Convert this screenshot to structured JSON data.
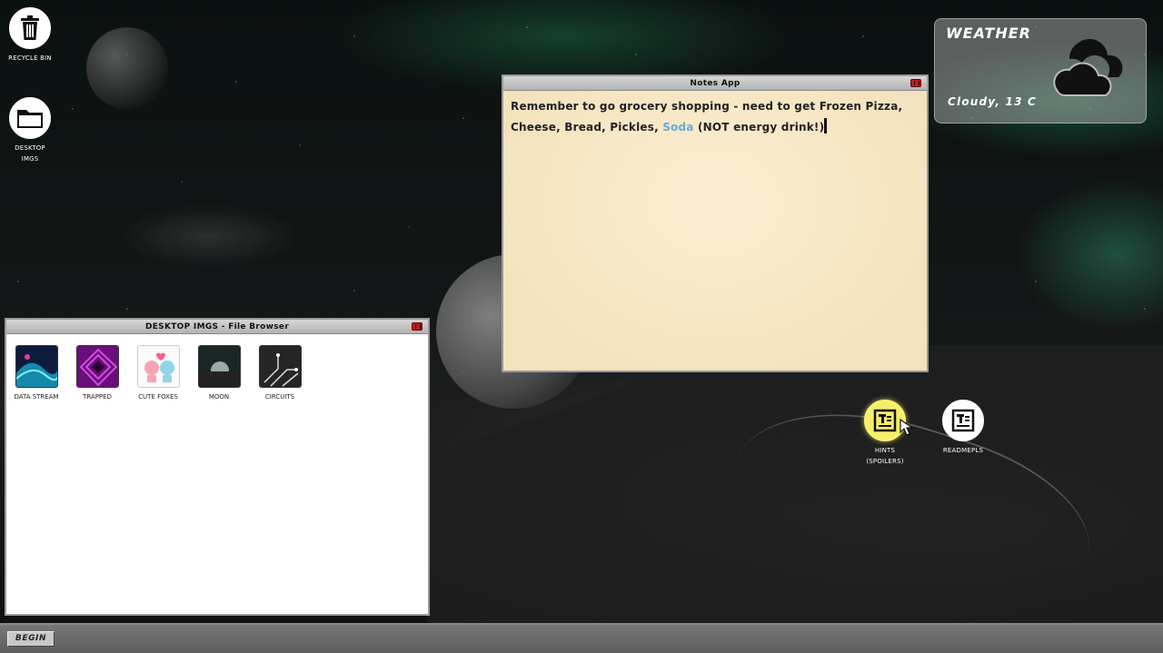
{
  "desktop": {
    "icons": [
      {
        "label": "RECYCLE BIN",
        "icon": "trash-icon"
      },
      {
        "label": "DESKTOP IMGS",
        "icon": "folder-icon"
      },
      {
        "label": "HINTS (SPOILERS)",
        "icon": "text-document-icon"
      },
      {
        "label": "READMEPLS",
        "icon": "text-document-icon"
      }
    ]
  },
  "notes_app": {
    "title": "Notes App",
    "text_before": "Remember to go grocery shopping - need to get Frozen Pizza, Cheese, Bread, Pickles, ",
    "text_highlight": "Soda",
    "text_after": " (NOT energy drink!)"
  },
  "file_browser": {
    "title": "DESKTOP IMGS - File Browser",
    "files": [
      {
        "label": "DATA STREAM"
      },
      {
        "label": "TRAPPED"
      },
      {
        "label": "CUTE FOXES"
      },
      {
        "label": "MOON"
      },
      {
        "label": "CIRCUITS"
      }
    ]
  },
  "weather": {
    "title": "WEATHER",
    "condition": "Cloudy, 13 C",
    "icon": "cloud-icon"
  },
  "taskbar": {
    "start_label": "BEGIN"
  },
  "colors": {
    "highlight_text": "#6aa8d8",
    "close_button": "#c01b1b",
    "hint_icon": "#f5ee6a",
    "notes_background": "#f6e6c4"
  }
}
